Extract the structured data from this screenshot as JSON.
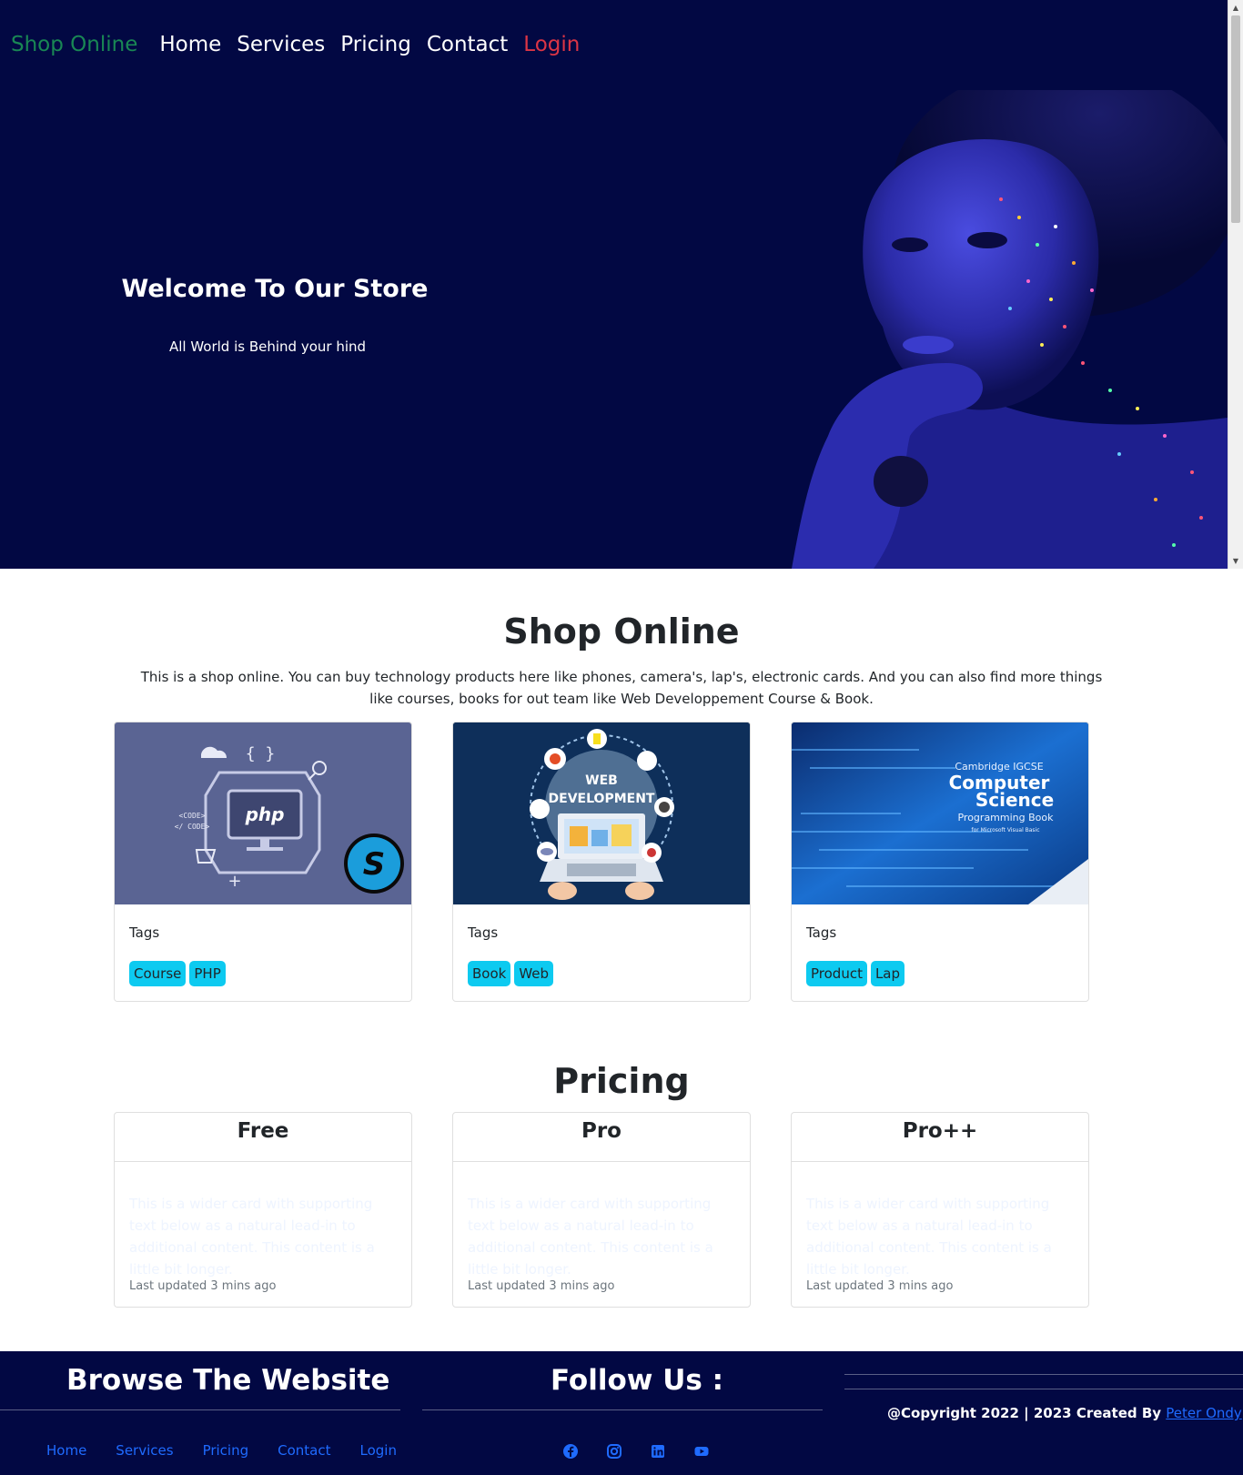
{
  "nav": {
    "brand": "Shop Online",
    "links": [
      "Home",
      "Services",
      "Pricing",
      "Contact"
    ],
    "login": "Login"
  },
  "hero": {
    "title": "Welcome To Our Store",
    "subtitle": "All World is Behind your hind"
  },
  "shop": {
    "title": "Shop Online",
    "description": "This is a shop online. You can buy technology products here like phones, camera's, lap's, electronic cards. And you can also find more things like courses, books for out team like Web Developpement Course & Book.",
    "cards": [
      {
        "tags_title": "Tags",
        "tags": [
          "Course",
          "PHP"
        ],
        "image_text": {
          "a": "php",
          "b": "<CODE>",
          "c": "</ CODE>",
          "d": "{ }"
        }
      },
      {
        "tags_title": "Tags",
        "tags": [
          "Book",
          "Web"
        ],
        "image_text": {
          "a": "WEB",
          "b": "DEVELOPMENT"
        }
      },
      {
        "tags_title": "Tags",
        "tags": [
          "Product",
          "Lap"
        ],
        "image_text": {
          "a": "Cambridge IGCSE",
          "b": "Computer",
          "c": "Science",
          "d": "Programming Book",
          "e": "for Microsoft Visual Basic"
        }
      }
    ]
  },
  "pricing": {
    "title": "Pricing",
    "plans": [
      {
        "name": "Free",
        "text": "This is a wider card with supporting text below as a natural lead-in to additional content. This content is a little bit longer.",
        "updated": "Last updated 3 mins ago"
      },
      {
        "name": "Pro",
        "text": "This is a wider card with supporting text below as a natural lead-in to additional content. This content is a little bit longer.",
        "updated": "Last updated 3 mins ago"
      },
      {
        "name": "Pro++",
        "text": "This is a wider card with supporting text below as a natural lead-in to additional content. This content is a little bit longer.",
        "updated": "Last updated 3 mins ago"
      }
    ]
  },
  "footer": {
    "browse_title": "Browse The Website",
    "follow_title": "Follow Us :",
    "links": [
      "Home",
      "Services",
      "Pricing",
      "Contact",
      "Login"
    ],
    "socials": [
      "facebook-icon",
      "instagram-icon",
      "linkedin-icon",
      "youtube-icon"
    ],
    "copyright": "@Copyright 2022 | 2023 Created By",
    "author": "Peter Ondy"
  },
  "colors": {
    "navy": "#020843",
    "brand_green": "#198754",
    "login_red": "#dc3545",
    "tag_cyan": "#0dcaf0",
    "link_blue": "#1f6bff"
  }
}
